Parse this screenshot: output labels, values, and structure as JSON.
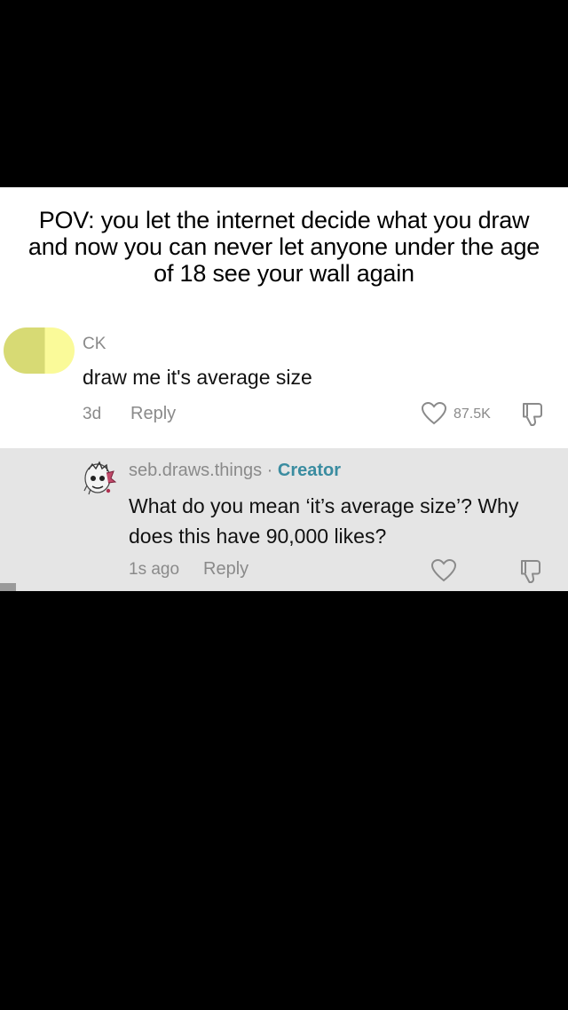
{
  "caption": {
    "text": "POV: you let the internet decide what you draw and now you can never let anyone under the age of 18 see your wall again"
  },
  "comment": {
    "author": "CK",
    "text": "draw me it's average size",
    "time": "3d",
    "reply_label": "Reply",
    "like_count": "87.5K",
    "avatar_colors": [
      "#d7da74",
      "#fafa99"
    ]
  },
  "reply": {
    "author": "seb.draws.things",
    "separator": "·",
    "badge": "Creator",
    "text": "What do you mean ‘it’s average size’? Why does this have 90,000 likes?",
    "time": "1s ago",
    "reply_label": "Reply",
    "badge_color": "#3a8ca0"
  },
  "icons": {
    "like": "heart-icon",
    "dislike": "dislike-icon"
  }
}
